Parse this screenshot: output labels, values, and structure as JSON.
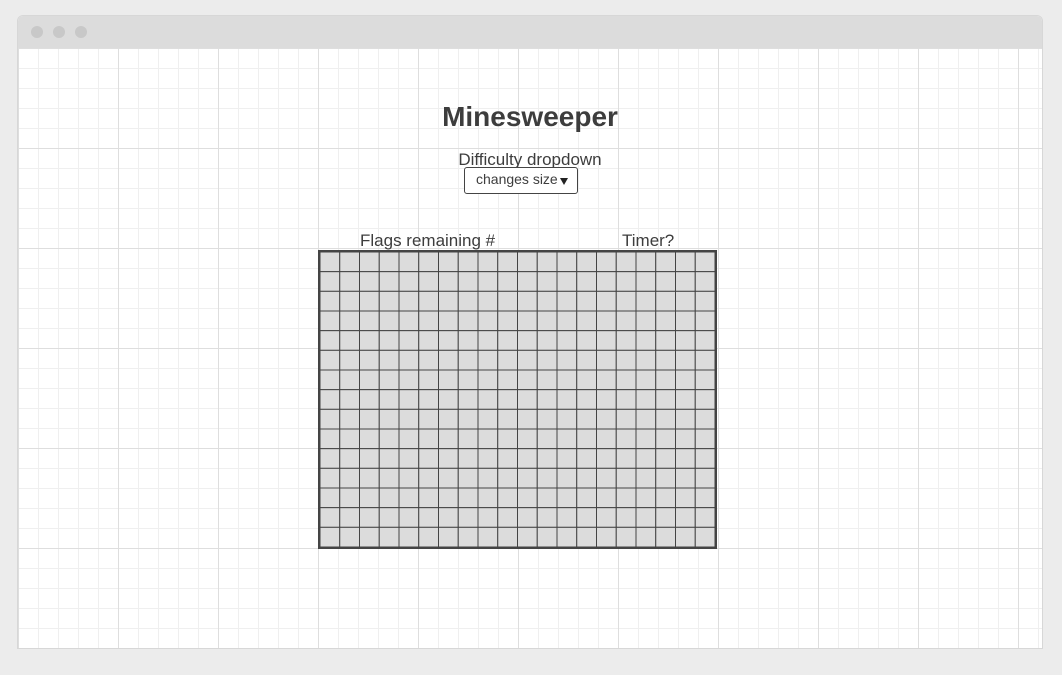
{
  "page": {
    "title": "Minesweeper",
    "difficulty_label": "Difficulty dropdown",
    "difficulty_select": {
      "selected": "changes size",
      "icon": "triangle-down-icon"
    },
    "flags_label": "Flags remaining #",
    "timer_label": "Timer?"
  },
  "board": {
    "columns": 20,
    "rows": 15,
    "cell_fill": "#dcdcdc",
    "line_color": "#444444"
  },
  "window": {
    "controls": [
      "window-dot",
      "window-dot",
      "window-dot"
    ]
  }
}
